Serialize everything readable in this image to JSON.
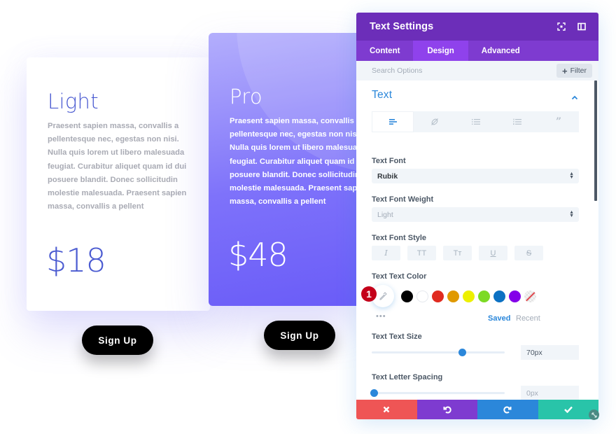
{
  "pricing": {
    "light": {
      "title": "Light",
      "description_lines": [
        "Praesent sapien massa, convallis a",
        "pellentesque nec, egestas non nisi.",
        "Nulla quis lorem ut libero malesuada",
        "feugiat. Curabitur aliquet quam id dui",
        "posuere blandit. Donec sollicitudin",
        "molestie malesuada. Praesent sapien",
        "massa, convallis a pellent"
      ],
      "price": "$18",
      "button_label": "Sign Up"
    },
    "pro": {
      "title": "Pro",
      "description_lines": [
        "Praesent sapien massa, convallis a",
        "pellentesque nec, egestas non nisi.",
        "Nulla quis lorem ut libero malesuada",
        "feugiat. Curabitur aliquet quam id dui",
        "posuere blandit. Donec sollicitudin",
        "molestie malesuada. Praesent sapien",
        "massa, convallis a pellent"
      ],
      "price": "$48",
      "button_label": "Sign Up"
    }
  },
  "settings_panel": {
    "title": "Text Settings",
    "header_icons": [
      "expand-icon",
      "split-view-icon"
    ],
    "tabs": [
      {
        "label": "Content",
        "active": false
      },
      {
        "label": "Design",
        "active": true
      },
      {
        "label": "Advanced",
        "active": false
      }
    ],
    "search": {
      "placeholder": "Search Options",
      "value": ""
    },
    "filter_label": "Filter",
    "section": {
      "title": "Text",
      "expanded": true,
      "text_modes": [
        "align-left-icon",
        "link-icon",
        "unordered-list-icon",
        "ordered-list-icon",
        "quote-icon"
      ],
      "active_mode": "align-left-icon",
      "text_font": {
        "label": "Text Font",
        "value": "Rubik"
      },
      "text_font_weight": {
        "label": "Text Font Weight",
        "value": "Light"
      },
      "text_font_style": {
        "label": "Text Font Style",
        "options": [
          "italic",
          "uppercase",
          "small-caps",
          "underline",
          "strikethrough"
        ],
        "glyphs": [
          "I",
          "TT",
          "Tт",
          "U",
          "S"
        ]
      },
      "text_color": {
        "label": "Text Text Color",
        "step_badge": "1",
        "swatches": [
          "#000000",
          "#ffffff",
          "#e02b20",
          "#e09900",
          "#edf000",
          "#7cda24",
          "#0c71c3",
          "#8300e9",
          "none"
        ],
        "more": "•••",
        "saved_label": "Saved",
        "recent_label": "Recent"
      },
      "text_size": {
        "label": "Text Text Size",
        "value": "70px",
        "slider_fraction": 0.68
      },
      "letter_spacing": {
        "label": "Text Letter Spacing",
        "value": "0px",
        "slider_fraction": 0.02
      }
    },
    "footer": [
      "cancel-icon",
      "undo-icon",
      "redo-icon",
      "save-icon"
    ]
  },
  "colors": {
    "header_purple": "#6c2eb9",
    "tabs_purple": "#7e3bd0",
    "active_tab": "#8f42ec",
    "accent_blue": "#2b87da",
    "cancel_red": "#ef5555",
    "save_green": "#29c4a9",
    "price_blue": "#4b5bd1"
  }
}
